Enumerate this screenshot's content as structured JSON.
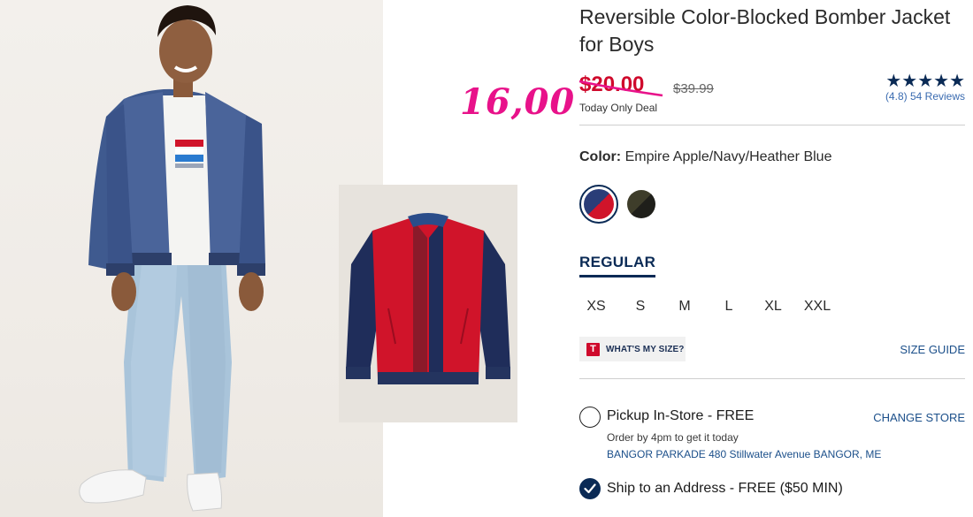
{
  "product": {
    "title": "Reversible Color-Blocked Bomber Jacket for Boys",
    "sale_price": "$20.00",
    "original_price": "$39.99",
    "deal_label": "Today Only Deal",
    "handwritten_price": "16,00"
  },
  "rating": {
    "stars": "★★★★★",
    "score": "(4.8)",
    "reviews": "54 Reviews",
    "value": 4.8
  },
  "color": {
    "label": "Color:",
    "value": "Empire Apple/Navy/Heather Blue",
    "swatches": [
      {
        "name": "Empire Apple/Navy/Heather Blue",
        "selected": true,
        "colors": [
          "#2a3d78",
          "#d0142a"
        ]
      },
      {
        "name": "Olive/Black",
        "selected": false,
        "colors": [
          "#3e3d2a",
          "#1f1f1a"
        ]
      }
    ]
  },
  "fit": {
    "label": "REGULAR"
  },
  "sizes": [
    "XS",
    "S",
    "M",
    "L",
    "XL",
    "XXL"
  ],
  "size_help": {
    "wms_label": "WHAT'S MY SIZE?",
    "wms_icon": "T",
    "guide_label": "SIZE GUIDE"
  },
  "fulfillment": {
    "pickup_label": "Pickup In-Store - FREE",
    "pickup_note": "Order by 4pm to get it today",
    "store_address": "BANGOR PARKADE 480 Stillwater Avenue  BANGOR, ME",
    "change_store_label": "CHANGE STORE",
    "ship_label": "Ship to an Address - FREE ($50 MIN)"
  },
  "colors": {
    "sale_red": "#cf0a2c",
    "navy": "#0a2a55",
    "link_blue": "#1b4f8a",
    "annotation_pink": "#e8128a"
  }
}
